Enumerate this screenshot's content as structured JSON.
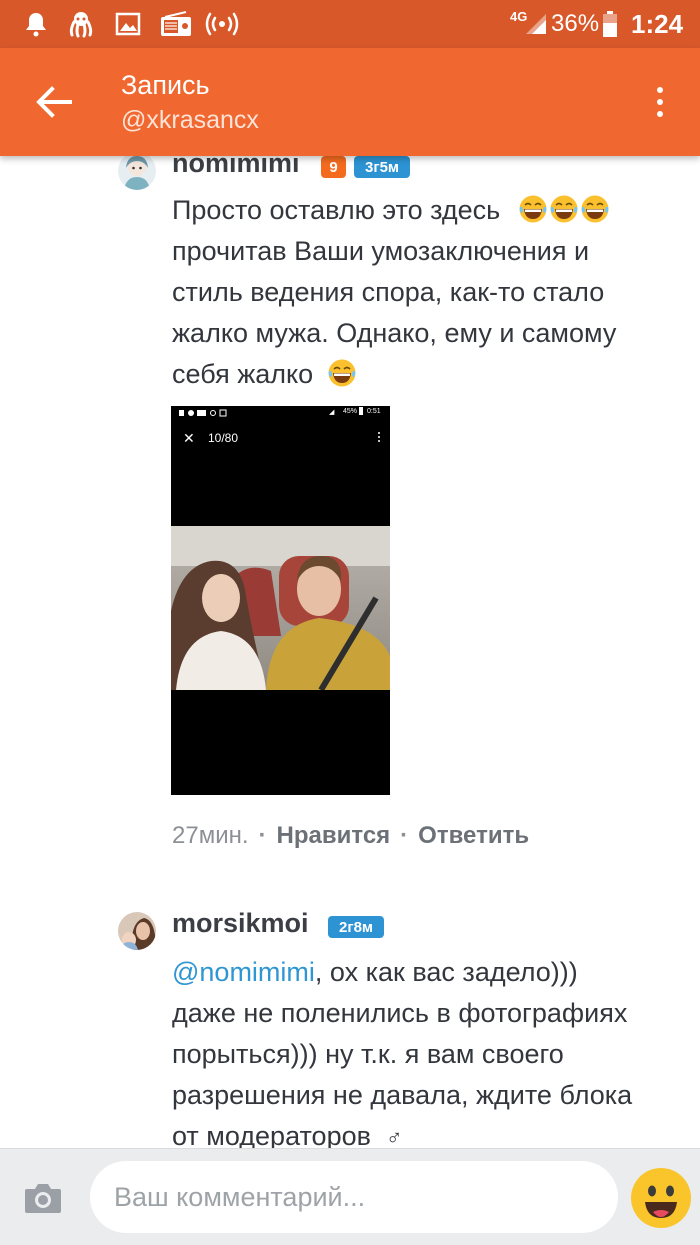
{
  "status_bar": {
    "network": "4G",
    "battery": "36%",
    "time": "1:24"
  },
  "app_bar": {
    "title": "Запись",
    "subtitle": "@xkrasancx"
  },
  "comments": [
    {
      "username": "nomimimi",
      "level_badge": "9",
      "time_badge": "3г5м",
      "text_lines": [
        "Просто оставлю это здесь",
        "прочитав Ваши умозаключения и",
        "стиль ведения спора, как-то стало",
        "жалко мужа. Однако, ему и самому",
        "себя жалко"
      ],
      "attachment": {
        "counter": "10/80",
        "battery": "45%",
        "time": "0:51"
      },
      "age": "27мин.",
      "like_label": "Нравится",
      "reply_label": "Ответить"
    },
    {
      "username": "morsikmoi",
      "time_badge": "2г8м",
      "mention": "@nomimimi",
      "text_lines": [
        ", ох как вас задело)))",
        "даже не поленились в фотографиях",
        "порыться))) ну т.к. я вам своего",
        "разрешения не давала, ждите блока",
        "от модераторов"
      ],
      "trailing_symbol": "♂"
    }
  ],
  "input": {
    "placeholder": "Ваш комментарий..."
  },
  "colors": {
    "status_bar": "#d8582a",
    "app_bar": "#f0672f",
    "level_badge": "#f46b1e",
    "time_badge": "#2d93d2",
    "mention": "#2f96d2"
  },
  "icons": {
    "back": "arrow-left-icon",
    "menu": "more-vertical-icon",
    "camera": "camera-icon",
    "smile": "smiley-icon",
    "emoji": "laughing-tears-emoji"
  }
}
